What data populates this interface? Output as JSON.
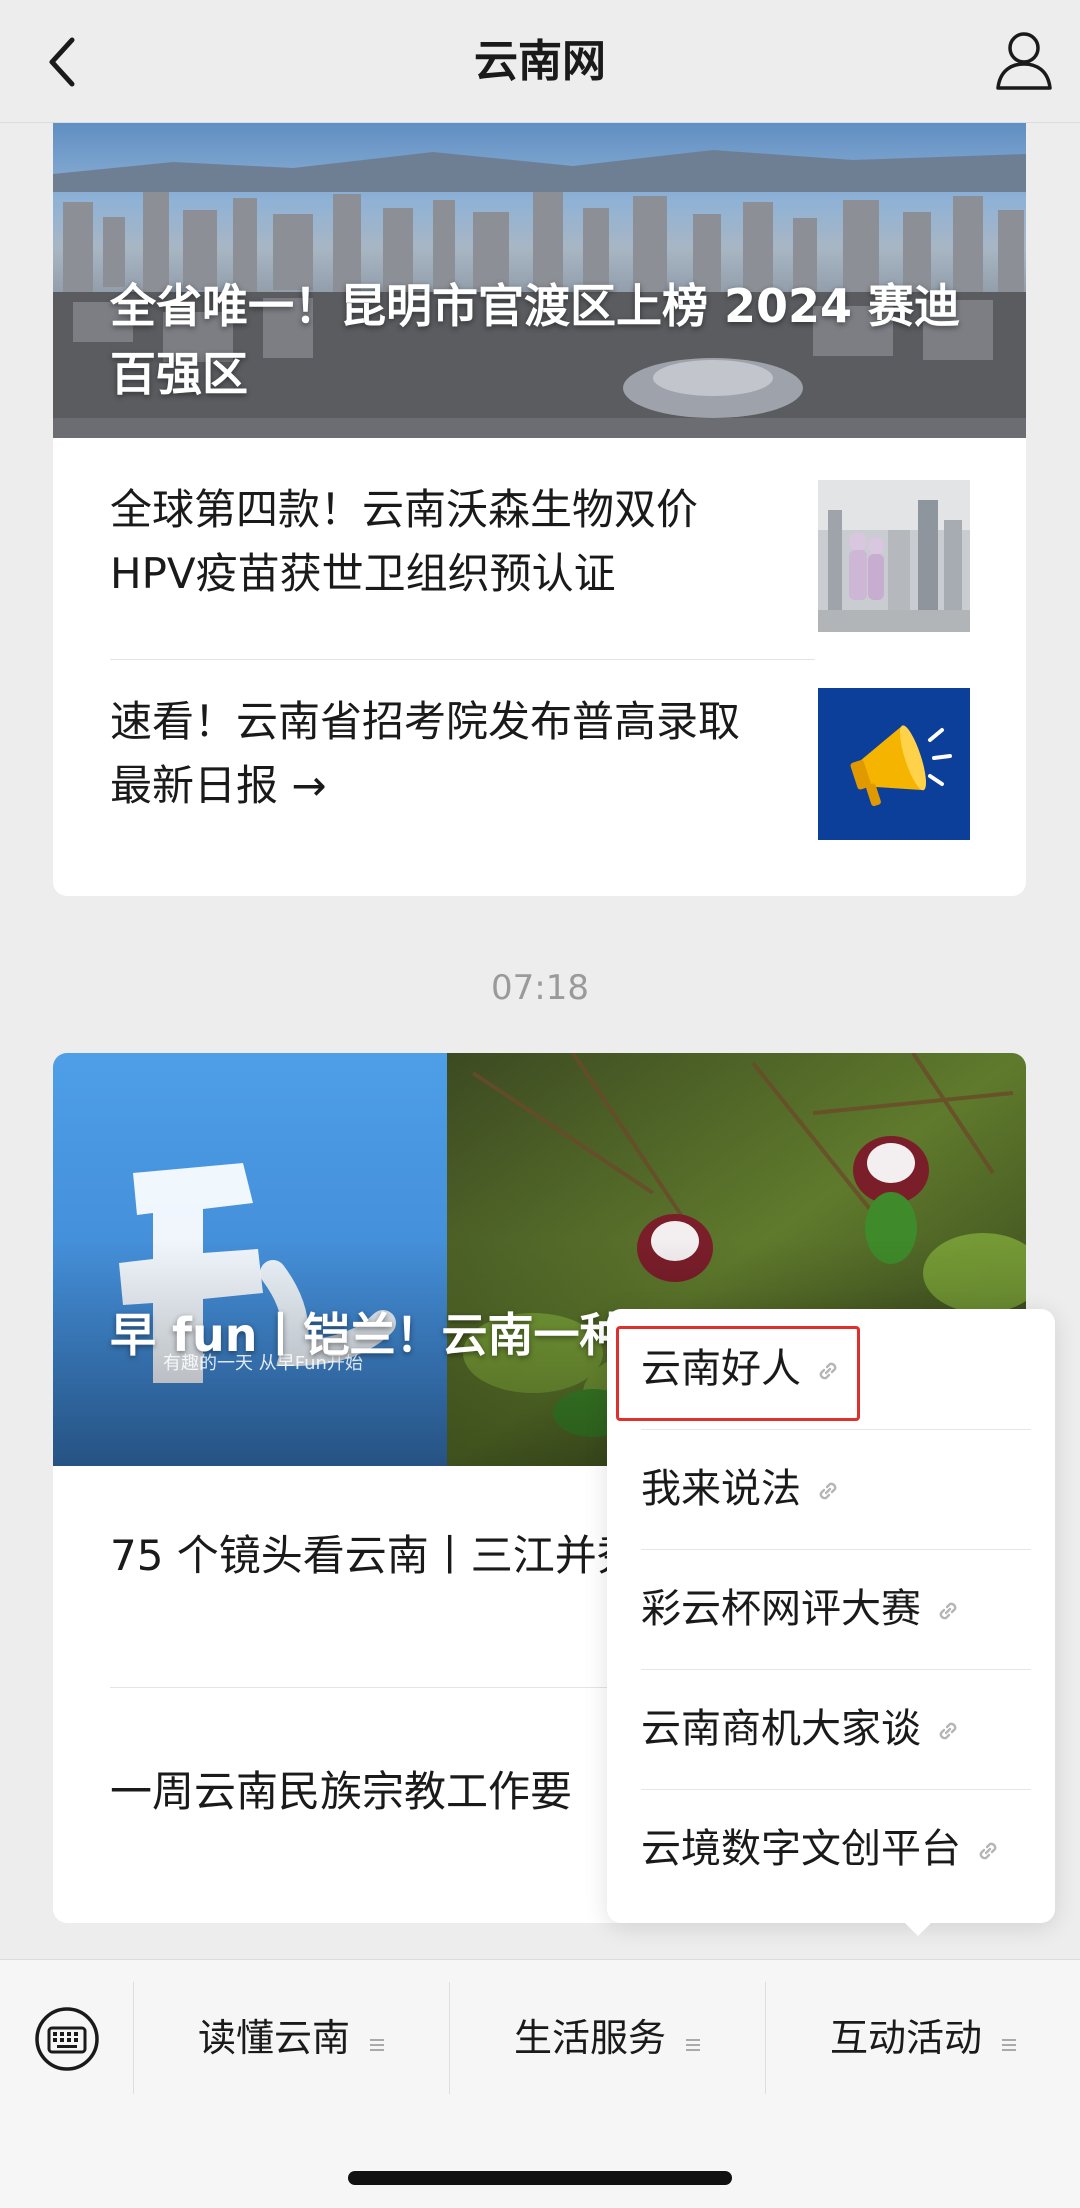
{
  "nav": {
    "title": "云南网"
  },
  "feed": {
    "card1": {
      "hero_title": "全省唯一！昆明市官渡区上榜 2024 赛迪百强区",
      "items": [
        {
          "title": "全球第四款！云南沃森生物双价HPV疫苗获世卫组织预认证"
        },
        {
          "title": "速看！云南省招考院发布普高录取最新日报 →"
        }
      ]
    },
    "timestamp": "07:18",
    "card2": {
      "hero_title": "早 fun丨铠兰！云南一种",
      "hero_overlay_text": "有趣的一天 从早Fun开始",
      "items": [
        {
          "title": "75 个镜头看云南丨三江并秀，这就很云南！"
        },
        {
          "title": "一周云南民族宗教工作要"
        }
      ]
    }
  },
  "popup_menu": {
    "items": [
      {
        "label": "云南好人",
        "highlighted": true
      },
      {
        "label": "我来说法"
      },
      {
        "label": "彩云杯网评大赛"
      },
      {
        "label": "云南商机大家谈"
      },
      {
        "label": "云境数字文创平台"
      }
    ]
  },
  "bottom_menu": {
    "tabs": [
      {
        "label": "读懂云南"
      },
      {
        "label": "生活服务"
      },
      {
        "label": "互动活动"
      }
    ]
  },
  "colors": {
    "highlight_border": "#e0302e",
    "megaphone_bg": "#0b3f9a"
  }
}
